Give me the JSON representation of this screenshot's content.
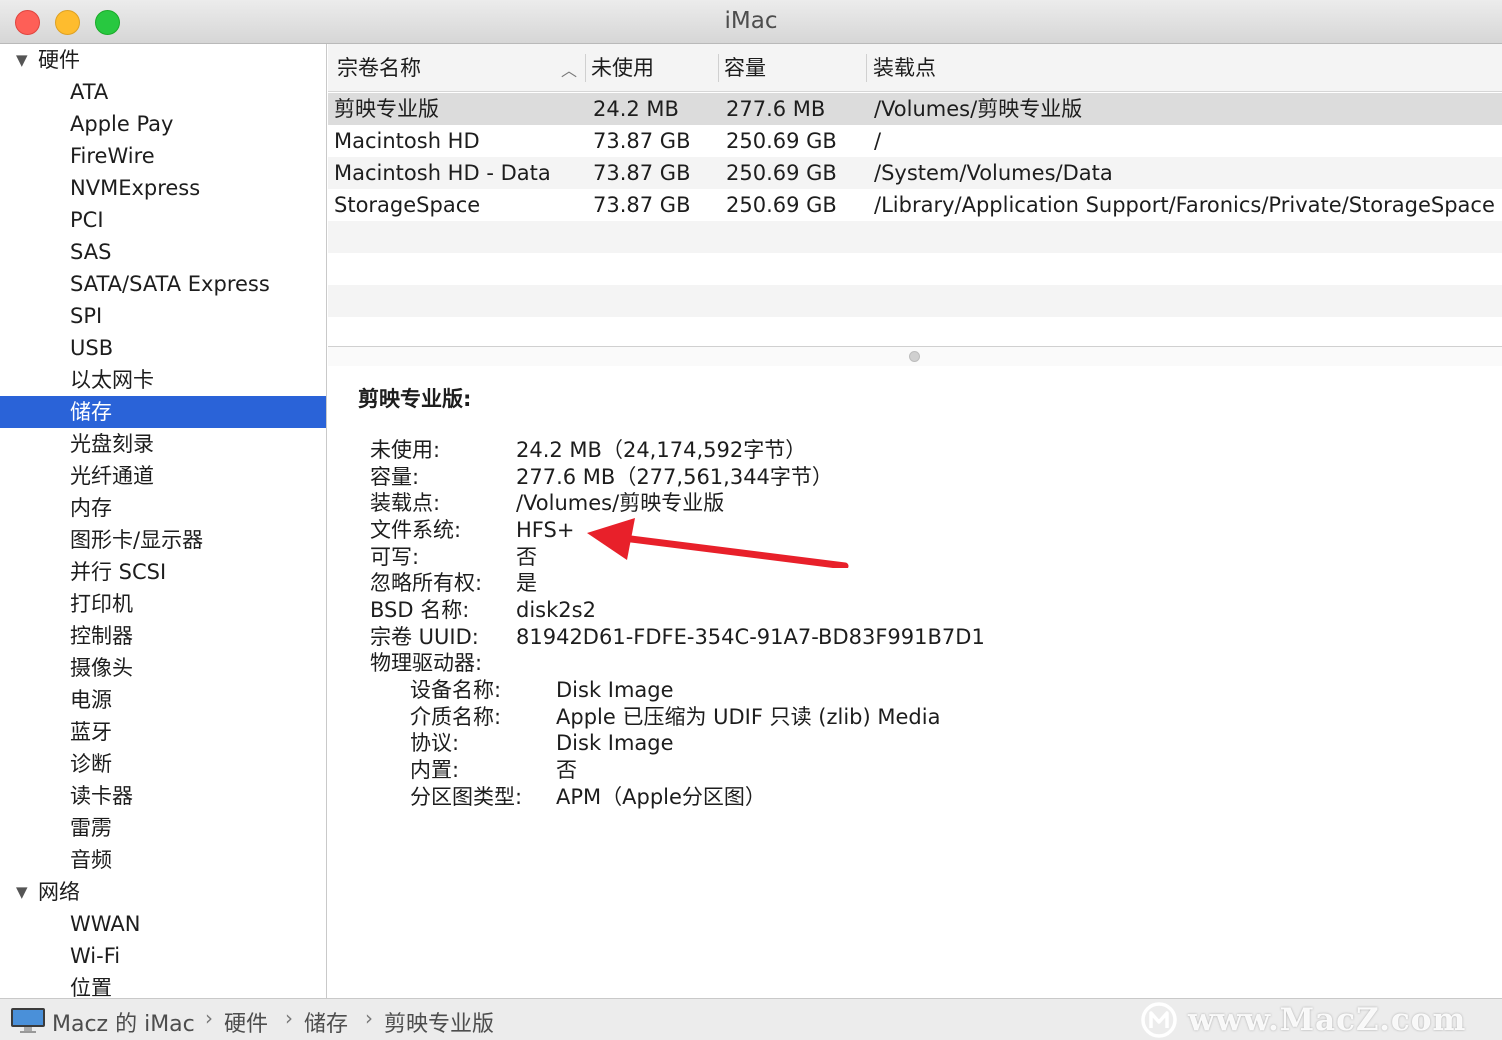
{
  "window": {
    "title": "iMac"
  },
  "sidebar": {
    "groups": [
      {
        "label": "硬件",
        "items": [
          "ATA",
          "Apple Pay",
          "FireWire",
          "NVMExpress",
          "PCI",
          "SAS",
          "SATA/SATA Express",
          "SPI",
          "USB",
          "以太网卡",
          "储存",
          "光盘刻录",
          "光纤通道",
          "内存",
          "图形卡/显示器",
          "并行 SCSI",
          "打印机",
          "控制器",
          "摄像头",
          "电源",
          "蓝牙",
          "诊断",
          "读卡器",
          "雷雳",
          "音频"
        ]
      },
      {
        "label": "网络",
        "items": [
          "WWAN",
          "Wi-Fi",
          "位置"
        ]
      }
    ],
    "selected": "储存"
  },
  "table": {
    "columns": [
      "宗卷名称",
      "未使用",
      "容量",
      "装载点"
    ],
    "rows": [
      {
        "name": "剪映专业版",
        "free": "24.2 MB",
        "capacity": "277.6 MB",
        "mount": "/Volumes/剪映专业版"
      },
      {
        "name": "Macintosh HD",
        "free": "73.87 GB",
        "capacity": "250.69 GB",
        "mount": "/"
      },
      {
        "name": "Macintosh HD - Data",
        "free": "73.87 GB",
        "capacity": "250.69 GB",
        "mount": "/System/Volumes/Data"
      },
      {
        "name": "StorageSpace",
        "free": "73.87 GB",
        "capacity": "250.69 GB",
        "mount": "/Library/Application Support/Faronics/Private/StorageSpace"
      }
    ]
  },
  "detail": {
    "title": "剪映专业版:",
    "fields": [
      {
        "label": "未使用:",
        "value": "24.2 MB（24,174,592字节）"
      },
      {
        "label": "容量:",
        "value": "277.6 MB（277,561,344字节）"
      },
      {
        "label": "装载点:",
        "value": "/Volumes/剪映专业版"
      },
      {
        "label": "文件系统:",
        "value": "HFS+"
      },
      {
        "label": "可写:",
        "value": "否"
      },
      {
        "label": "忽略所有权:",
        "value": "是"
      },
      {
        "label": "BSD 名称:",
        "value": "disk2s2"
      },
      {
        "label": "宗卷 UUID:",
        "value": "81942D61-FDFE-354C-91A7-BD83F991B7D1"
      },
      {
        "label": "物理驱动器:",
        "value": ""
      }
    ],
    "drive_fields": [
      {
        "label": "设备名称:",
        "value": "Disk Image"
      },
      {
        "label": "介质名称:",
        "value": "Apple 已压缩为 UDIF 只读 (zlib) Media"
      },
      {
        "label": "协议:",
        "value": "Disk Image"
      },
      {
        "label": "内置:",
        "value": "否"
      },
      {
        "label": "分区图类型:",
        "value": "APM（Apple分区图）"
      }
    ]
  },
  "breadcrumb": [
    "Macz 的 iMac",
    "硬件",
    "储存",
    "剪映专业版"
  ],
  "watermark": "www.MacZ.com",
  "icons": {
    "sidebar_group": "disclosure-triangle-icon",
    "sort": "sort-ascending-icon",
    "computer": "imac-icon",
    "annotation": "red-arrow-icon"
  },
  "colors": {
    "selection": "#2a63d8",
    "annotation_arrow": "#e8202a"
  }
}
